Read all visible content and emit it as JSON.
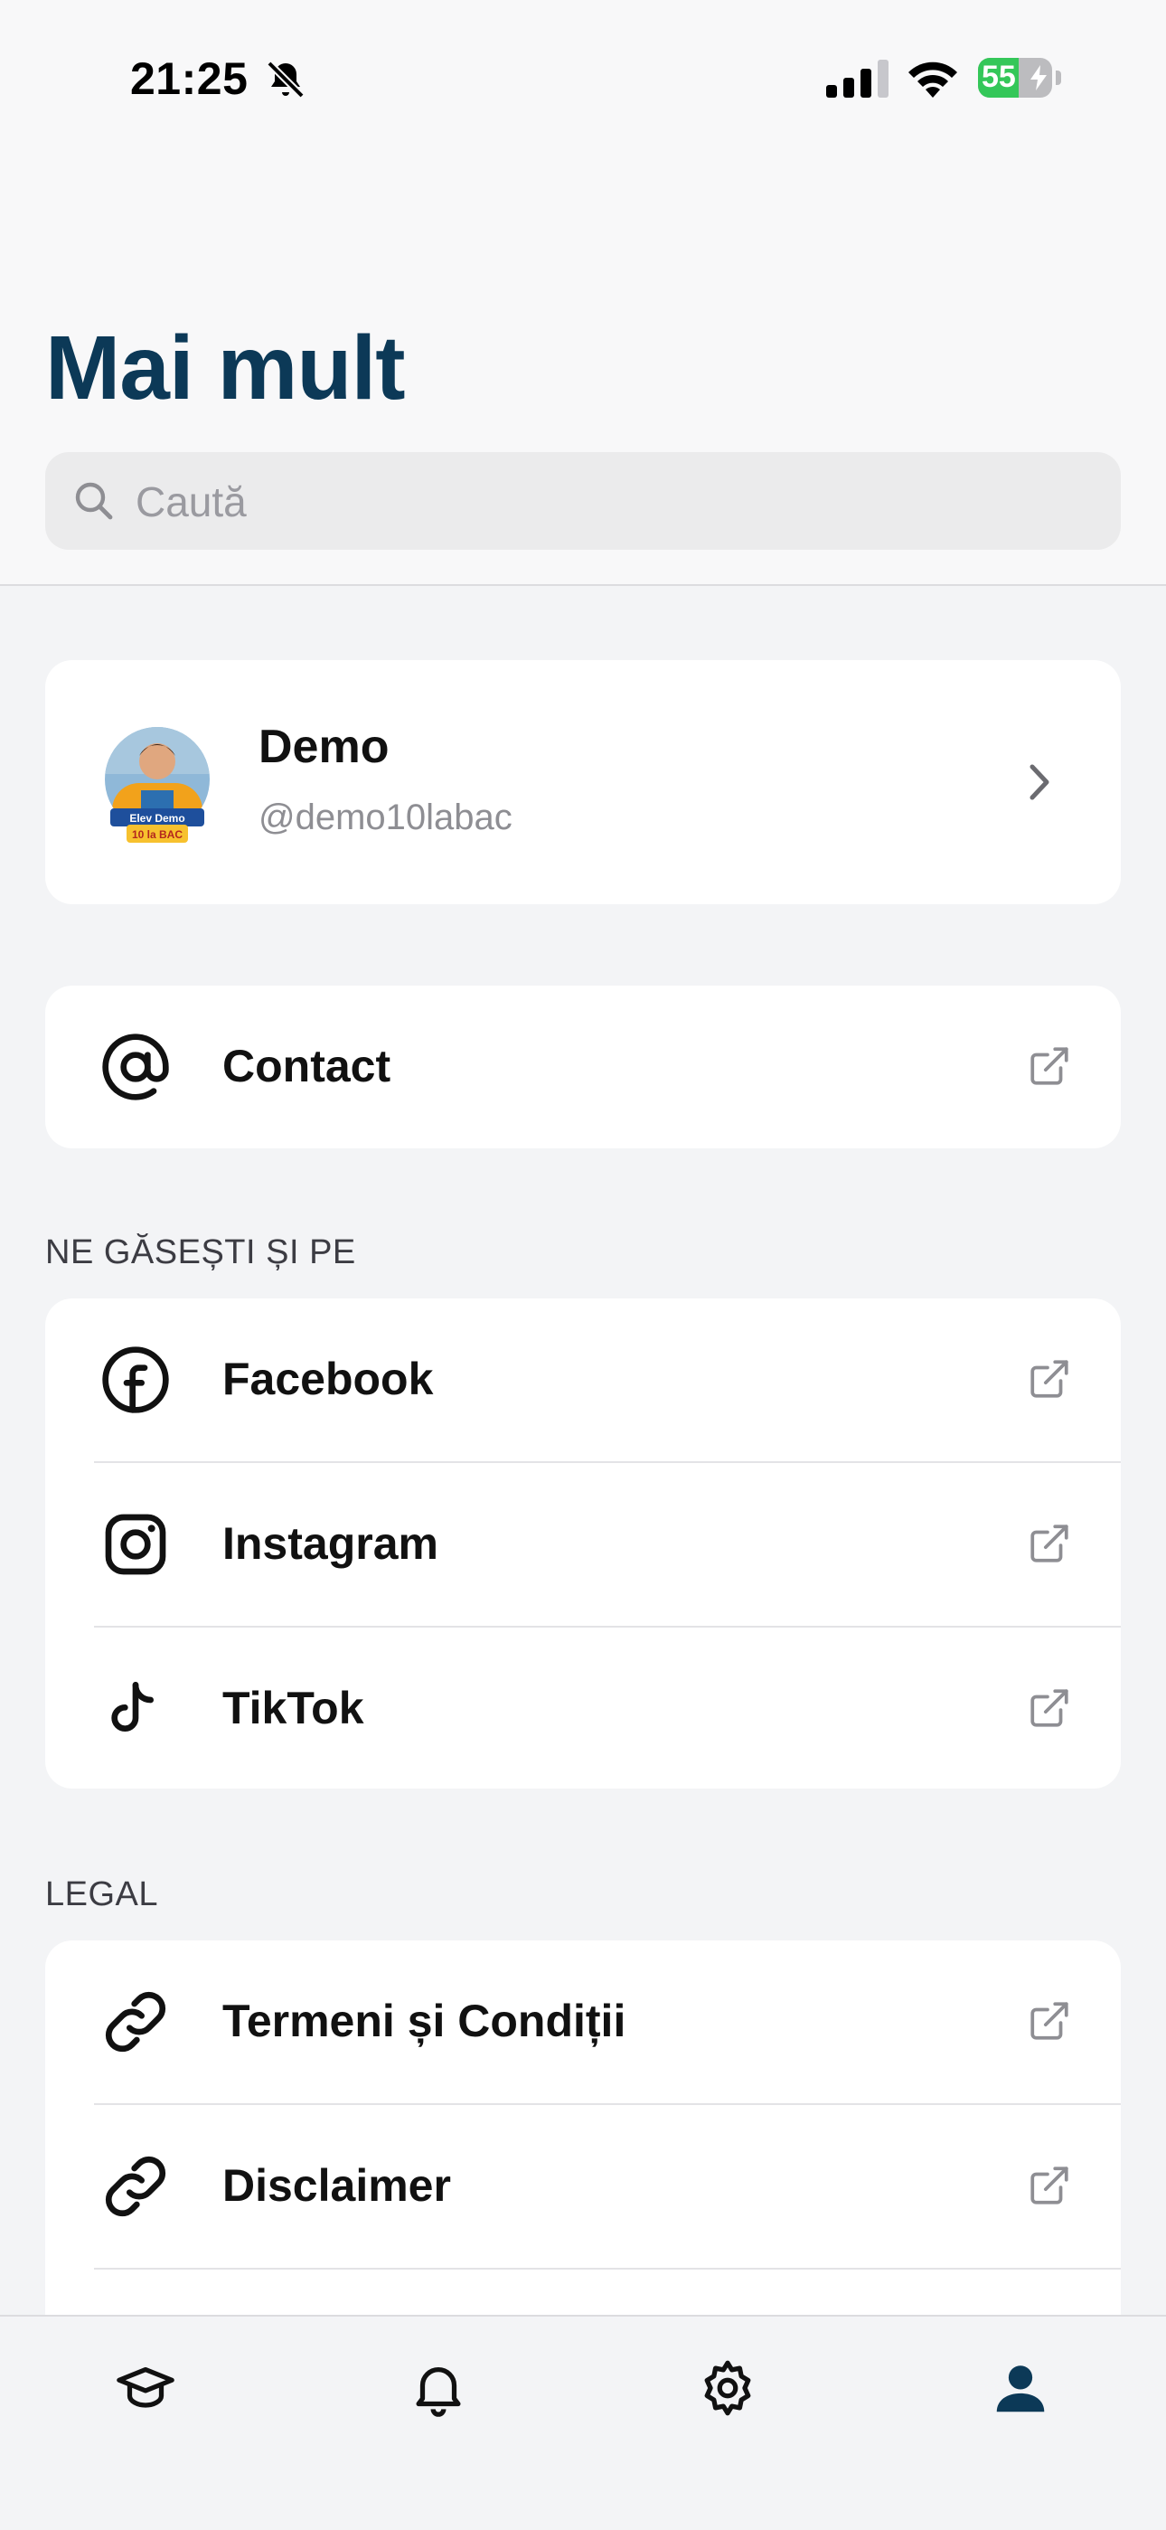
{
  "status_bar": {
    "time": "21:25",
    "battery": "55",
    "battery_fraction": 0.55,
    "icons": [
      "bell-slash-icon",
      "signal-icon",
      "wifi-icon",
      "battery-icon"
    ]
  },
  "header": {
    "title": "Mai mult",
    "search": {
      "placeholder": "Caută",
      "value": ""
    }
  },
  "profile": {
    "name": "Demo",
    "handle": "@demo10labac",
    "avatar_badge_line1": "Elev Demo",
    "avatar_badge_line2": "10 la BAC"
  },
  "contact": {
    "label": "Contact",
    "icon": "at-icon"
  },
  "social_section": {
    "header": "NE GĂSEȘTI ȘI PE",
    "items": [
      {
        "label": "Facebook",
        "icon": "facebook-icon"
      },
      {
        "label": "Instagram",
        "icon": "instagram-icon"
      },
      {
        "label": "TikTok",
        "icon": "tiktok-icon"
      }
    ]
  },
  "legal_section": {
    "header": "LEGAL",
    "items": [
      {
        "label": "Termeni și Condiții",
        "icon": "link-icon"
      },
      {
        "label": "Disclaimer",
        "icon": "link-icon"
      }
    ]
  },
  "tab_bar": {
    "tabs": [
      {
        "icon": "graduation-cap-icon",
        "active": false
      },
      {
        "icon": "bell-icon",
        "active": false
      },
      {
        "icon": "gear-icon",
        "active": false
      },
      {
        "icon": "person-icon",
        "active": true
      }
    ]
  },
  "colors": {
    "accent": "#0c3957",
    "battery_green": "#34c759",
    "background": "#f3f4f6",
    "card": "#ffffff"
  }
}
